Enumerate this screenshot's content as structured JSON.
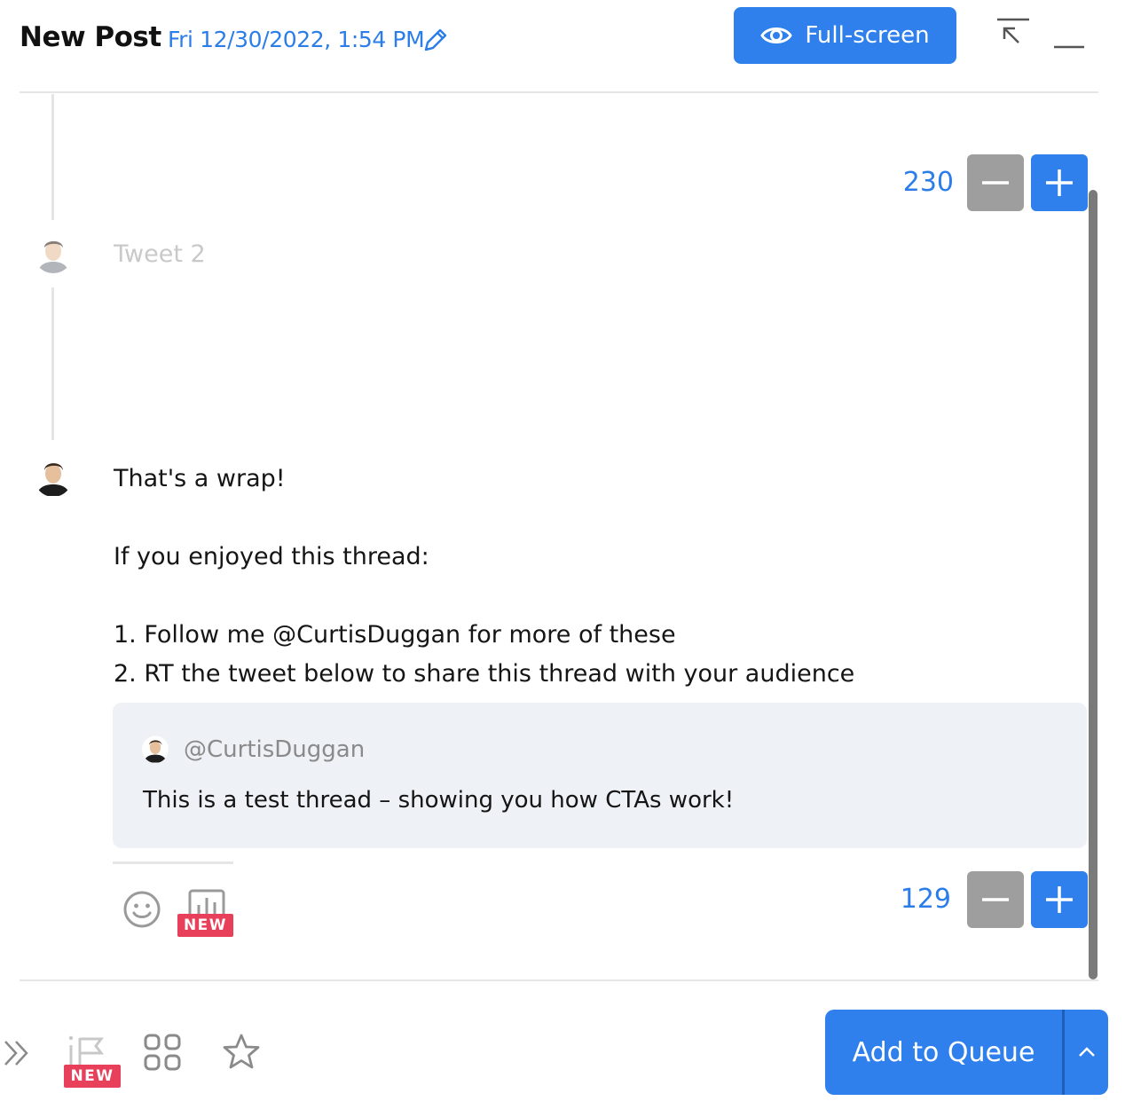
{
  "header": {
    "title": "New Post",
    "date": "Fri 12/30/2022, 1:54 PM",
    "fullscreen_label": "Full-screen"
  },
  "tweets": [
    {
      "counter": "230",
      "placeholder": "Tweet 2"
    },
    {
      "counter": "129",
      "lines": [
        "That's a wrap!",
        "",
        "If you enjoyed this thread:",
        "",
        "1. Follow me @CurtisDuggan for more of these",
        "2. RT the tweet below to share this thread with your audience"
      ],
      "quote": {
        "handle": "@CurtisDuggan",
        "text": "This is a test thread – showing you how CTAs work!"
      }
    }
  ],
  "badges": {
    "new": "NEW"
  },
  "footer": {
    "add_queue_label": "Add to Queue"
  },
  "colors": {
    "accent": "#2f80ed",
    "badge": "#e8405a",
    "muted": "#9e9e9e"
  },
  "icons": [
    "edit-icon",
    "eye-icon",
    "collapse-icon",
    "minimize-icon",
    "minus-icon",
    "plus-icon",
    "emoji-icon",
    "poll-icon",
    "chevrons-right-icon",
    "flag-icon",
    "grid-icon",
    "star-icon",
    "chevron-up-icon"
  ]
}
